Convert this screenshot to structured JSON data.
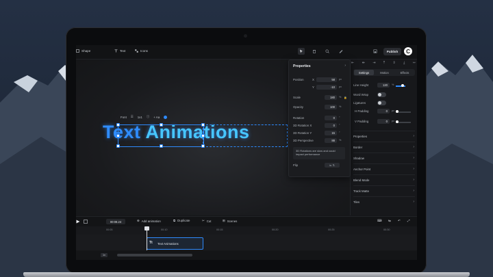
{
  "topbar": {
    "items": [
      {
        "label": "Shape"
      },
      {
        "label": "Text"
      },
      {
        "label": "Icons"
      }
    ],
    "publish_label": "Publish",
    "logo_glyph": "C"
  },
  "canvas": {
    "headline_word1": "Text",
    "headline_word2": "Animations",
    "headline_colors": {
      "primary": "#2f8dff",
      "secondary": "#47c6ff"
    },
    "float_toolbar": {
      "font_label": "Font",
      "size_label": "1x1",
      "add_label": "+ Aa"
    }
  },
  "properties": {
    "title": "Properties",
    "position_label": "Position",
    "x_label": "X",
    "x_value": "58",
    "y_label": "Y",
    "y_value": "-10",
    "unit_px": "px",
    "scale_label": "Scale",
    "scale_value": "180",
    "unit_pct": "%",
    "opacity_label": "Opacity",
    "opacity_value": "100",
    "rotation_label": "Rotation",
    "rotation_value": "0",
    "rot_x_label": "3D Rotation X",
    "rot_x_value": "0",
    "rot_y_label": "3D Rotation Y",
    "rot_y_value": "15",
    "perspective_label": "3D Perspective",
    "perspective_value": "88",
    "unit_deg": "°",
    "note": "3D Rotations are slow and could impact performance",
    "flip_label": "Flip"
  },
  "right_panel": {
    "tabs": [
      "Settings",
      "Motion",
      "Effects"
    ],
    "line_height_label": "Line Height",
    "line_height_value": "120",
    "word_wrap_label": "Word Wrap",
    "ligatures_label": "Ligatures",
    "h_padding_label": "H Padding",
    "h_padding_value": "0",
    "v_padding_label": "V Padding",
    "v_padding_value": "0",
    "sections": [
      "Properties",
      "Border",
      "Shadow",
      "Anchor Point",
      "Blend Mode",
      "Track Matte",
      "Tiles"
    ]
  },
  "timeline": {
    "time": "00:08.24",
    "buttons": [
      "Add animation",
      "Duplicate",
      "Cut",
      "Scenes"
    ],
    "ticks": [
      "00:05",
      "00:10",
      "00:15",
      "00:20",
      "00:25",
      "00:30"
    ],
    "clip_label": "Text Animations",
    "clip_glyph": "Tt",
    "zoom_label": "1x"
  },
  "accent": "#2e8bff"
}
